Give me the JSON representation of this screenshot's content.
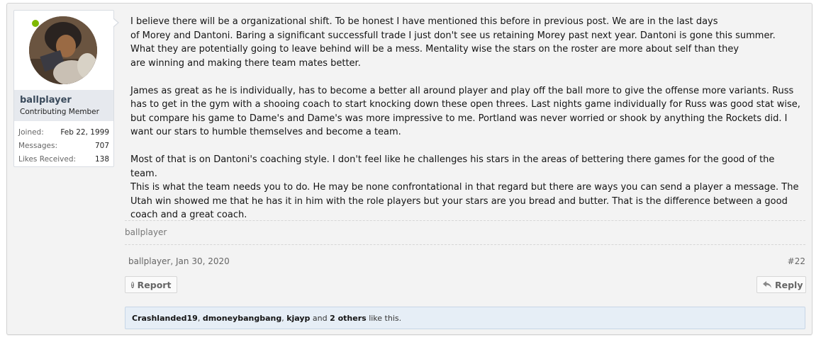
{
  "user": {
    "username": "ballplayer",
    "title": "Contributing Member",
    "online_color": "#7fb900",
    "stats": [
      {
        "label": "Joined:",
        "value": "Feb 22, 1999"
      },
      {
        "label": "Messages:",
        "value": "707"
      },
      {
        "label": "Likes Received:",
        "value": "138"
      }
    ]
  },
  "post": {
    "paragraphs": [
      "I believe there will be a organizational shift. To be honest I have mentioned this before in previous post. We are in the last days\nof Morey and Dantoni. Baring a significant successfull trade I just don't see us retaining Morey past next year. Dantoni is gone this summer.\nWhat they are potentially going to leave behind will be a mess. Mentality wise the stars on the roster are more about self than they\nare winning and making there team mates better.",
      "James as great as he is individually, has to become a better all around player and play off the ball more to give the offense more variants. Russ\nhas to get in the gym with a shooing coach to start knocking down these open threes. Last nights game individually for Russ was good stat wise,\nbut compare his game to Dame's and Dame's was more impressive to me. Portland was never worried or shook by anything the Rockets did. I\nwant our stars to humble themselves and become a team.",
      "Most of that is on Dantoni's coaching style. I don't feel like he challenges his stars in the areas of bettering there games for the good of the team.\nThis is what the team needs you to do. He may be none confrontational in that regard but there are ways you can send a player a message. The\nUtah win showed me that he has it in him with the role players but your stars are you bread and butter. That is the difference between a good\ncoach and a great coach."
    ],
    "signature": "ballplayer",
    "author": "ballplayer",
    "date": "Jan 30, 2020",
    "number": "#22",
    "report_label": "Report",
    "reply_label": "Reply"
  },
  "likes": {
    "users": [
      "Crashlanded19",
      "dmoneybangbang",
      "kjayp"
    ],
    "others": "2 others",
    "suffix": "like this."
  }
}
